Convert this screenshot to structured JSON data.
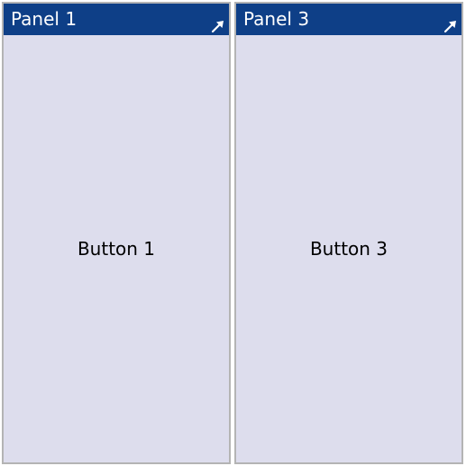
{
  "colors": {
    "titlebar": "#0e3f87",
    "panel_background": "#dddded",
    "panel_border": "#b4b4b4"
  },
  "panels": [
    {
      "title": "Panel 1",
      "maximize_icon": "arrow-up-right-icon",
      "button_label": "Button 1"
    },
    {
      "title": "Panel 3",
      "maximize_icon": "arrow-up-right-icon",
      "button_label": "Button 3"
    }
  ]
}
